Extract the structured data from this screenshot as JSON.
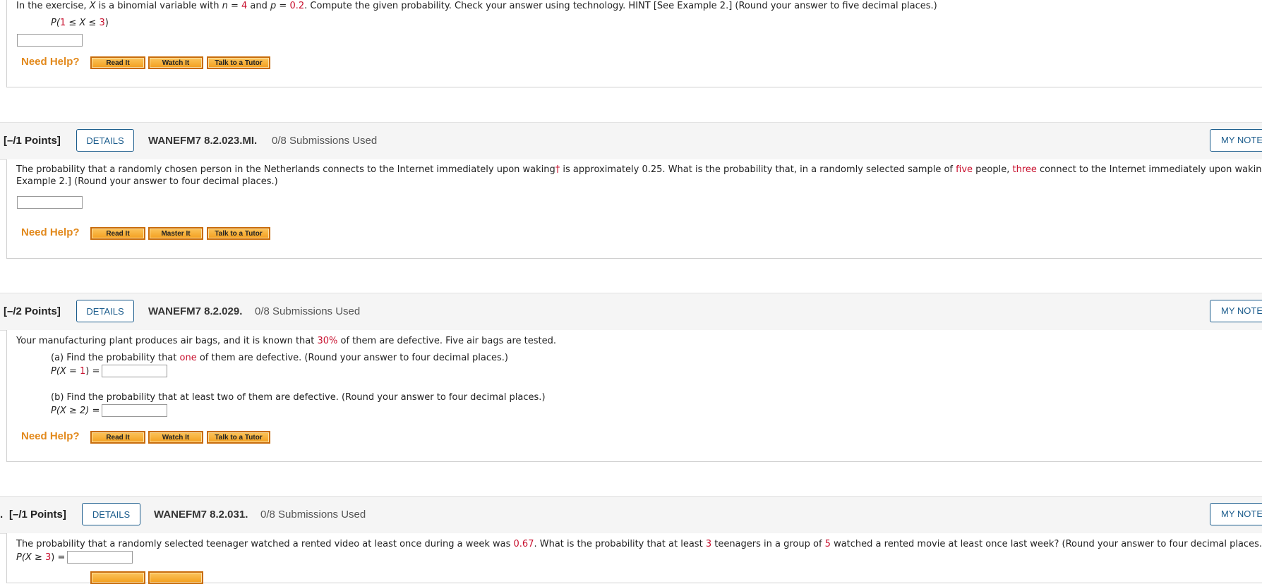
{
  "q1": {
    "line_pre": "In the exercise, ",
    "var_x": "X",
    "line_mid1": " is a binomial variable with ",
    "var_n": "n",
    "eq_n": " = ",
    "n_val": "4",
    "line_mid2": " and ",
    "var_p": "p",
    "eq_p": " = ",
    "p_val": "0.2",
    "line_post": ". Compute the given probability. Check your answer using technology. HINT [See Example 2.] (Round your answer to five decimal places.)",
    "prob_pre": "P(",
    "prob_one": "1",
    "prob_mid": " ≤ X ≤ ",
    "prob_three": "3",
    "prob_post": ")",
    "need_help": "Need Help?",
    "buttons": [
      "Read It",
      "Watch It",
      "Talk to a Tutor"
    ]
  },
  "q2": {
    "points": "[–/1 Points]",
    "details": "DETAILS",
    "id": "WANEFM7 8.2.023.MI.",
    "submissions": "0/8 Submissions Used",
    "my_notes": "MY NOTES",
    "text_a": "The probability that a randomly chosen person in the Netherlands connects to the Internet immediately upon waking",
    "dagger": "†",
    "text_b": " is approximately 0.25. What is the probability that, in a randomly selected sample of ",
    "five": "five",
    "text_c": " people, ",
    "three": "three",
    "text_d": " connect to the Internet immediately upon waking? HINT [See",
    "text_e": "Example 2.] (Round your answer to four decimal places.)",
    "need_help": "Need Help?",
    "buttons": [
      "Read It",
      "Master It",
      "Talk to a Tutor"
    ]
  },
  "q3": {
    "points": "[–/2 Points]",
    "details": "DETAILS",
    "id": "WANEFM7 8.2.029.",
    "submissions": "0/8 Submissions Used",
    "my_notes": "MY NOTES",
    "intro_a": "Your manufacturing plant produces air bags, and it is known that ",
    "pct": "30%",
    "intro_b": " of them are defective. Five air bags are tested.",
    "a_pre": "(a) Find the probability that ",
    "a_one": "one",
    "a_post": " of them are defective. (Round your answer to four decimal places.)",
    "a_eq_pre": "P(X = ",
    "a_eq_val": "1",
    "a_eq_post": ") =",
    "b_text": "(b) Find the probability that at least two of them are defective. (Round your answer to four decimal places.)",
    "b_eq": "P(X ≥ 2) =",
    "need_help": "Need Help?",
    "buttons": [
      "Read It",
      "Watch It",
      "Talk to a Tutor"
    ]
  },
  "q4": {
    "num_prefix": ".",
    "points": "[–/1 Points]",
    "details": "DETAILS",
    "id": "WANEFM7 8.2.031.",
    "submissions": "0/8 Submissions Used",
    "my_notes": "MY NOTES",
    "text_a": "The probability that a randomly selected teenager watched a rented video at least once during a week was ",
    "p_val": "0.67",
    "text_b": ". What is the probability that at least ",
    "k_val": "3",
    "text_c": " teenagers in a group of ",
    "n_val": "5",
    "text_d": " watched a rented movie at least once last week? (Round your answer to four decimal places.)",
    "eq_pre": "P(X ≥ ",
    "eq_val": "3",
    "eq_post": ") ="
  }
}
